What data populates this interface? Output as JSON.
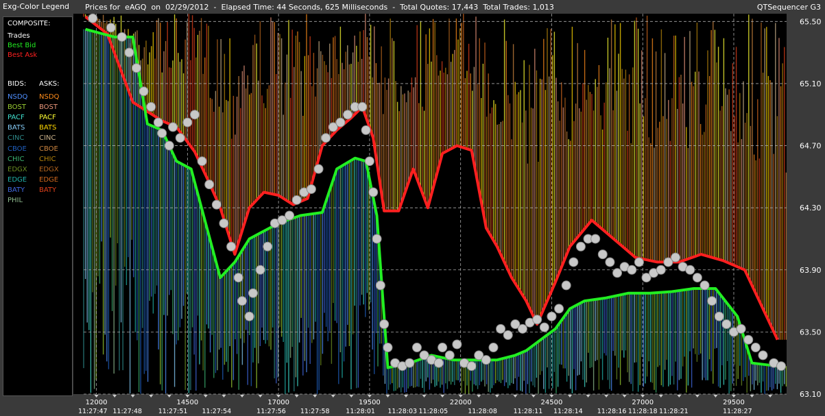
{
  "app": {
    "name": "QTSequencer G3"
  },
  "legend": {
    "title": "Exg-Color Legend",
    "composite_label": "COMPOSITE:",
    "composite": [
      {
        "label": "Trades",
        "color": "#ffffff"
      },
      {
        "label": "Best Bid",
        "color": "#22ee22"
      },
      {
        "label": "Best Ask",
        "color": "#ff2020"
      }
    ],
    "bids_label": "BIDS:",
    "asks_label": "ASKS:",
    "bids": [
      {
        "label": "NSDQ",
        "color": "#4f8fff"
      },
      {
        "label": "BOST",
        "color": "#9acd32"
      },
      {
        "label": "PACF",
        "color": "#40e0d0"
      },
      {
        "label": "BATS",
        "color": "#87cefa"
      },
      {
        "label": "CINC",
        "color": "#2e8b8b"
      },
      {
        "label": "CBOE",
        "color": "#1f5fbf"
      },
      {
        "label": "CHIC",
        "color": "#3cb371"
      },
      {
        "label": "EDGX",
        "color": "#6b8e23"
      },
      {
        "label": "EDGE",
        "color": "#20b2aa"
      },
      {
        "label": "BATY",
        "color": "#4169e1"
      },
      {
        "label": "PHIL",
        "color": "#8fbc8f"
      }
    ],
    "asks": [
      {
        "label": "NSDQ",
        "color": "#ff8c1a"
      },
      {
        "label": "BOST",
        "color": "#e9967a"
      },
      {
        "label": "PACF",
        "color": "#ffff33"
      },
      {
        "label": "BATS",
        "color": "#ffd700"
      },
      {
        "label": "CINC",
        "color": "#cdb38b"
      },
      {
        "label": "CBOE",
        "color": "#cd853f"
      },
      {
        "label": "CHIC",
        "color": "#b8860b"
      },
      {
        "label": "EDGX",
        "color": "#b5651d"
      },
      {
        "label": "EDGE",
        "color": "#d2691e"
      },
      {
        "label": "BATY",
        "color": "#e0401a"
      }
    ]
  },
  "header": {
    "title": "Prices for  eAGQ  on  02/29/2012  -  Elapsed Time: 44 Seconds, 625 Milliseconds  -  Total Quotes: 17,443  Total Trades: 1,013"
  },
  "chart_data": {
    "type": "scatter",
    "title": "Prices for eAGQ on 02/29/2012",
    "y_axis": {
      "ticks": [
        "65.50",
        "65.10",
        "64.70",
        "64.30",
        "63.90",
        "63.50",
        "63.10"
      ],
      "ylim": [
        63.1,
        65.55
      ],
      "position": "right"
    },
    "x_axis": {
      "ticks": [
        "12000",
        "14500",
        "17000",
        "19500",
        "22000",
        "24500",
        "27000",
        "29500"
      ],
      "tick_values": [
        12000,
        14500,
        17000,
        19500,
        22000,
        24500,
        27000,
        29500
      ],
      "time_labels": [
        "11:27:47",
        "11:27:48",
        "11:27:51",
        "11:27:54",
        "11:27:56",
        "11:27:58",
        "11:28:01",
        "11:28:03",
        "11:28:05",
        "11:28:08",
        "11:28:11",
        "11:28:14",
        "11:28:16",
        "11:28:18",
        "11:28:21",
        "11:28:27"
      ],
      "time_label_x": [
        11900,
        12850,
        14100,
        15300,
        16800,
        18000,
        19250,
        20400,
        21250,
        22600,
        23850,
        24950,
        26150,
        27000,
        27850,
        29600
      ],
      "xlim": [
        11650,
        30950
      ]
    },
    "grid": "dashed",
    "best_ask": [
      [
        11700,
        65.53
      ],
      [
        12300,
        65.42
      ],
      [
        13000,
        64.98
      ],
      [
        13400,
        64.92
      ],
      [
        13800,
        64.86
      ],
      [
        14200,
        64.82
      ],
      [
        14700,
        64.66
      ],
      [
        15100,
        64.46
      ],
      [
        15400,
        64.3
      ],
      [
        15800,
        64.0
      ],
      [
        16200,
        64.3
      ],
      [
        16600,
        64.4
      ],
      [
        17000,
        64.38
      ],
      [
        17400,
        64.32
      ],
      [
        17800,
        64.36
      ],
      [
        18200,
        64.7
      ],
      [
        18600,
        64.8
      ],
      [
        19000,
        64.88
      ],
      [
        19300,
        64.95
      ],
      [
        19600,
        64.75
      ],
      [
        19900,
        64.28
      ],
      [
        20300,
        64.28
      ],
      [
        20700,
        64.55
      ],
      [
        21100,
        64.3
      ],
      [
        21500,
        64.65
      ],
      [
        21900,
        64.7
      ],
      [
        22300,
        64.67
      ],
      [
        22700,
        64.17
      ],
      [
        23000,
        64.05
      ],
      [
        23400,
        63.85
      ],
      [
        23800,
        63.7
      ],
      [
        24100,
        63.55
      ],
      [
        24600,
        63.82
      ],
      [
        25000,
        64.05
      ],
      [
        25600,
        64.22
      ],
      [
        26200,
        64.1
      ],
      [
        26800,
        63.98
      ],
      [
        27400,
        63.95
      ],
      [
        28000,
        63.95
      ],
      [
        28600,
        64.0
      ],
      [
        29200,
        63.96
      ],
      [
        29800,
        63.9
      ],
      [
        30200,
        63.7
      ],
      [
        30700,
        63.45
      ]
    ],
    "best_bid": [
      [
        11700,
        65.45
      ],
      [
        12500,
        65.4
      ],
      [
        13000,
        65.4
      ],
      [
        13400,
        64.84
      ],
      [
        13800,
        64.8
      ],
      [
        14200,
        64.6
      ],
      [
        14600,
        64.55
      ],
      [
        15000,
        64.2
      ],
      [
        15400,
        63.85
      ],
      [
        15800,
        63.95
      ],
      [
        16200,
        64.1
      ],
      [
        16600,
        64.15
      ],
      [
        17000,
        64.2
      ],
      [
        17600,
        64.25
      ],
      [
        18200,
        64.27
      ],
      [
        18600,
        64.55
      ],
      [
        19100,
        64.62
      ],
      [
        19400,
        64.6
      ],
      [
        19700,
        64.25
      ],
      [
        20000,
        63.27
      ],
      [
        20600,
        63.3
      ],
      [
        21200,
        63.35
      ],
      [
        21800,
        63.32
      ],
      [
        22400,
        63.32
      ],
      [
        23000,
        63.32
      ],
      [
        23500,
        63.35
      ],
      [
        23800,
        63.38
      ],
      [
        24200,
        63.45
      ],
      [
        24600,
        63.52
      ],
      [
        25000,
        63.65
      ],
      [
        25400,
        63.7
      ],
      [
        26000,
        63.72
      ],
      [
        26600,
        63.75
      ],
      [
        27200,
        63.75
      ],
      [
        27800,
        63.76
      ],
      [
        28400,
        63.78
      ],
      [
        29000,
        63.78
      ],
      [
        29600,
        63.6
      ],
      [
        30000,
        63.3
      ],
      [
        30700,
        63.28
      ]
    ],
    "trades": [
      [
        11900,
        65.52
      ],
      [
        12400,
        65.46
      ],
      [
        12700,
        65.4
      ],
      [
        12900,
        65.3
      ],
      [
        13100,
        65.2
      ],
      [
        13300,
        65.05
      ],
      [
        13500,
        64.95
      ],
      [
        13700,
        64.85
      ],
      [
        13800,
        64.78
      ],
      [
        14000,
        64.7
      ],
      [
        14100,
        64.82
      ],
      [
        14300,
        64.75
      ],
      [
        14500,
        64.85
      ],
      [
        14700,
        64.9
      ],
      [
        14900,
        64.6
      ],
      [
        15100,
        64.45
      ],
      [
        15300,
        64.32
      ],
      [
        15500,
        64.2
      ],
      [
        15700,
        64.05
      ],
      [
        15900,
        63.85
      ],
      [
        16000,
        63.7
      ],
      [
        16200,
        63.6
      ],
      [
        16300,
        63.75
      ],
      [
        16500,
        63.9
      ],
      [
        16700,
        64.05
      ],
      [
        16900,
        64.2
      ],
      [
        17100,
        64.22
      ],
      [
        17300,
        64.25
      ],
      [
        17500,
        64.35
      ],
      [
        17700,
        64.4
      ],
      [
        17900,
        64.42
      ],
      [
        18100,
        64.55
      ],
      [
        18300,
        64.75
      ],
      [
        18500,
        64.82
      ],
      [
        18700,
        64.85
      ],
      [
        18900,
        64.9
      ],
      [
        19100,
        64.95
      ],
      [
        19300,
        64.95
      ],
      [
        19400,
        64.8
      ],
      [
        19500,
        64.6
      ],
      [
        19600,
        64.4
      ],
      [
        19700,
        64.1
      ],
      [
        19800,
        63.8
      ],
      [
        19900,
        63.55
      ],
      [
        20000,
        63.4
      ],
      [
        20200,
        63.3
      ],
      [
        20400,
        63.28
      ],
      [
        20600,
        63.3
      ],
      [
        20800,
        63.4
      ],
      [
        21000,
        63.35
      ],
      [
        21200,
        63.32
      ],
      [
        21400,
        63.3
      ],
      [
        21500,
        63.4
      ],
      [
        21700,
        63.35
      ],
      [
        21900,
        63.42
      ],
      [
        22100,
        63.3
      ],
      [
        22300,
        63.28
      ],
      [
        22500,
        63.35
      ],
      [
        22700,
        63.32
      ],
      [
        22900,
        63.4
      ],
      [
        23100,
        63.52
      ],
      [
        23300,
        63.48
      ],
      [
        23500,
        63.55
      ],
      [
        23700,
        63.52
      ],
      [
        23900,
        63.56
      ],
      [
        24100,
        63.58
      ],
      [
        24300,
        63.53
      ],
      [
        24500,
        63.6
      ],
      [
        24700,
        63.65
      ],
      [
        24900,
        63.8
      ],
      [
        25100,
        63.95
      ],
      [
        25300,
        64.05
      ],
      [
        25500,
        64.1
      ],
      [
        25700,
        64.1
      ],
      [
        25900,
        64.0
      ],
      [
        26100,
        63.95
      ],
      [
        26300,
        63.88
      ],
      [
        26500,
        63.92
      ],
      [
        26700,
        63.9
      ],
      [
        26900,
        63.95
      ],
      [
        27100,
        63.85
      ],
      [
        27300,
        63.88
      ],
      [
        27500,
        63.9
      ],
      [
        27700,
        63.95
      ],
      [
        27900,
        63.98
      ],
      [
        28100,
        63.92
      ],
      [
        28300,
        63.9
      ],
      [
        28500,
        63.85
      ],
      [
        28700,
        63.8
      ],
      [
        28900,
        63.7
      ],
      [
        29100,
        63.6
      ],
      [
        29300,
        63.55
      ],
      [
        29500,
        63.5
      ],
      [
        29700,
        63.52
      ],
      [
        29900,
        63.45
      ],
      [
        30100,
        63.4
      ],
      [
        30300,
        63.35
      ],
      [
        30600,
        63.3
      ],
      [
        30800,
        63.28
      ]
    ]
  }
}
